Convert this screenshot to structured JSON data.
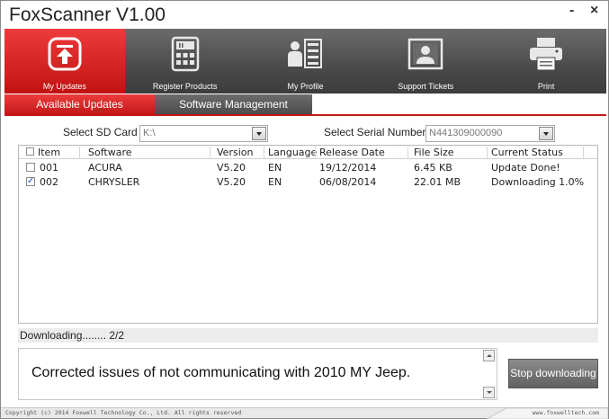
{
  "window": {
    "title": "FoxScanner  V1.00",
    "minimize_label": "-",
    "close_label": "×"
  },
  "toolbar": {
    "items": [
      {
        "label": "My Updates",
        "icon": "upload-icon",
        "active": true
      },
      {
        "label": "Register Products",
        "icon": "device-icon",
        "active": false
      },
      {
        "label": "My Profile",
        "icon": "profile-icon",
        "active": false
      },
      {
        "label": "Support Tickets",
        "icon": "support-icon",
        "active": false
      },
      {
        "label": "Print",
        "icon": "printer-icon",
        "active": false
      }
    ]
  },
  "subtabs": [
    {
      "label": "Available Updates",
      "active": true
    },
    {
      "label": "Software Management",
      "active": false
    }
  ],
  "selectors": {
    "sd_card_label": "Select SD Card",
    "sd_card_value": "K:\\",
    "serial_label": "Select Serial Number",
    "serial_value": "N441309000090"
  },
  "list": {
    "columns": [
      "Item",
      "Software",
      "Version",
      "Language",
      "Release Date",
      "File Size",
      "Current Status"
    ],
    "rows": [
      {
        "checked": false,
        "item": "001",
        "software": "ACURA",
        "version": "V5.20",
        "language": "EN",
        "release_date": "19/12/2014",
        "file_size": "6.45 KB",
        "status": "Update Done!"
      },
      {
        "checked": true,
        "item": "002",
        "software": "CHRYSLER",
        "version": "V5.20",
        "language": "EN",
        "release_date": "06/08/2014",
        "file_size": "22.01 MB",
        "status": "Downloading 1.0%"
      }
    ]
  },
  "status": {
    "text": "Downloading........  2/2"
  },
  "description": {
    "text": "Corrected issues of not communicating with 2010 MY Jeep."
  },
  "actions": {
    "stop_label": "Stop downloading"
  },
  "footer": {
    "copyright": "Copyright (c) 2014 Foxwell Technology Co., Ltd. All rights reserved",
    "website": "www.foxwelltech.com"
  },
  "colors": {
    "accent_red": "#c41818",
    "toolbar_dark": "#4a4a4a",
    "check_blue": "#1a4fc0"
  }
}
